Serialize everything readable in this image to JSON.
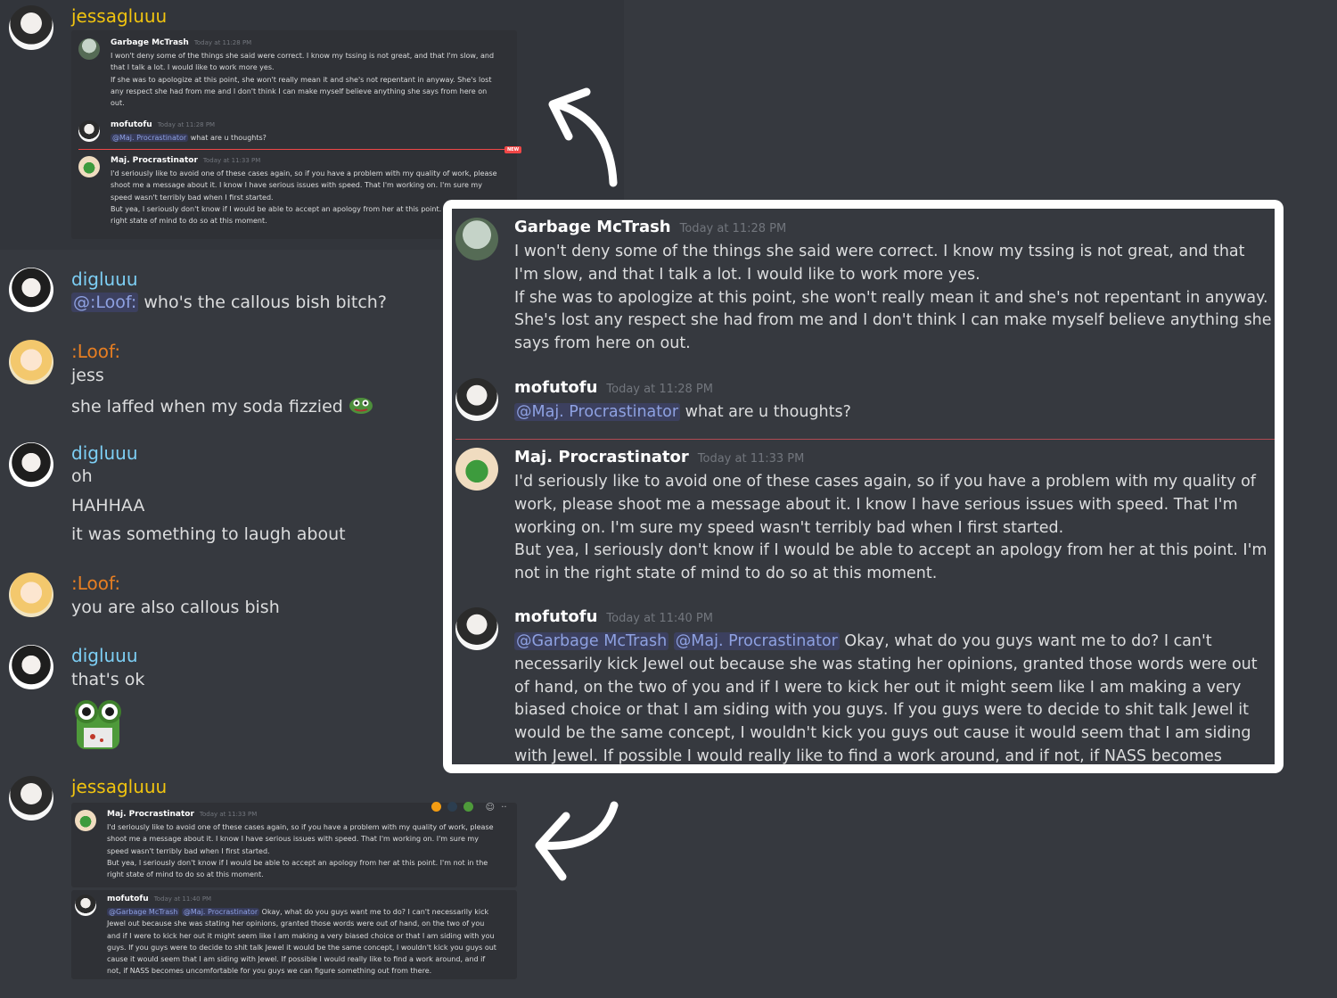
{
  "colors": {
    "background": "#36393f",
    "username_yellow": "#f1c40f",
    "username_blue": "#7dcff5",
    "username_orange": "#e67e22",
    "mention": "#8ea1e1",
    "new_divider": "#f04747"
  },
  "messages": [
    {
      "user": "jessagluuu"
    },
    {
      "user": "digluuu",
      "mention": "@:Loof:",
      "text": "who's the callous bish bitch?"
    },
    {
      "user": ":Loof:",
      "lines": [
        "jess",
        "she laffed when my soda fizzied"
      ],
      "emoji": "pepe-emoji"
    },
    {
      "user": "digluuu",
      "lines": [
        "oh",
        "HAHHAA",
        "it was something to laugh about"
      ]
    },
    {
      "user": ":Loof:",
      "lines": [
        "you are also callous bish"
      ]
    },
    {
      "user": "digluuu",
      "lines": [
        "that's ok"
      ],
      "sticker": "frog-sticker"
    },
    {
      "user": "jessagluuu"
    }
  ],
  "quoted": {
    "garbage": {
      "name": "Garbage McTrash",
      "time": "Today at 11:28 PM",
      "text": "I won't deny some of the things she said were correct. I know my tssing is not great, and that I'm slow, and that I talk a lot. I would like to work more yes.",
      "text2": "If she was to apologize at this point, she won't really mean it and she's not repentant in anyway. She's lost any respect she had from me and I don't think I can make myself believe anything she says from here on out."
    },
    "mofutofu1": {
      "name": "mofutofu",
      "time": "Today at 11:28 PM",
      "mention": "@Maj. Procrastinator",
      "text": "what are u thoughts?"
    },
    "maj": {
      "name": "Maj. Procrastinator",
      "time": "Today at 11:33 PM",
      "text": "I'd seriously like to avoid one of these cases again, so if you have a problem with my quality of work, please shoot me a message about it. I know I have serious issues with speed. That I'm working on. I'm sure my speed wasn't terribly bad when I first started.",
      "text2": "But yea, I seriously don't know if I would be able to accept an apology from her at this point. I'm not in the right state of mind to do so at this moment."
    },
    "mofutofu2": {
      "name": "mofutofu",
      "time": "Today at 11:40 PM",
      "mention1": "@Garbage McTrash",
      "mention2": "@Maj. Procrastinator",
      "text": "Okay, what do you guys want me to do? I can't necessarily kick Jewel out because she was stating her opinions, granted those words were out of hand, on the two of you and if I were to kick her out it might seem like I am making a very biased choice or that I am siding with you guys. If you guys were to decide to shit talk Jewel it would be the same concept, I wouldn't kick you guys out cause it would seem that I am siding with Jewel. If possible I would really like to find a work around, and if not, if NASS becomes uncomfortable for you guys we can figure something out from there."
    },
    "new_badge": "NEW"
  }
}
